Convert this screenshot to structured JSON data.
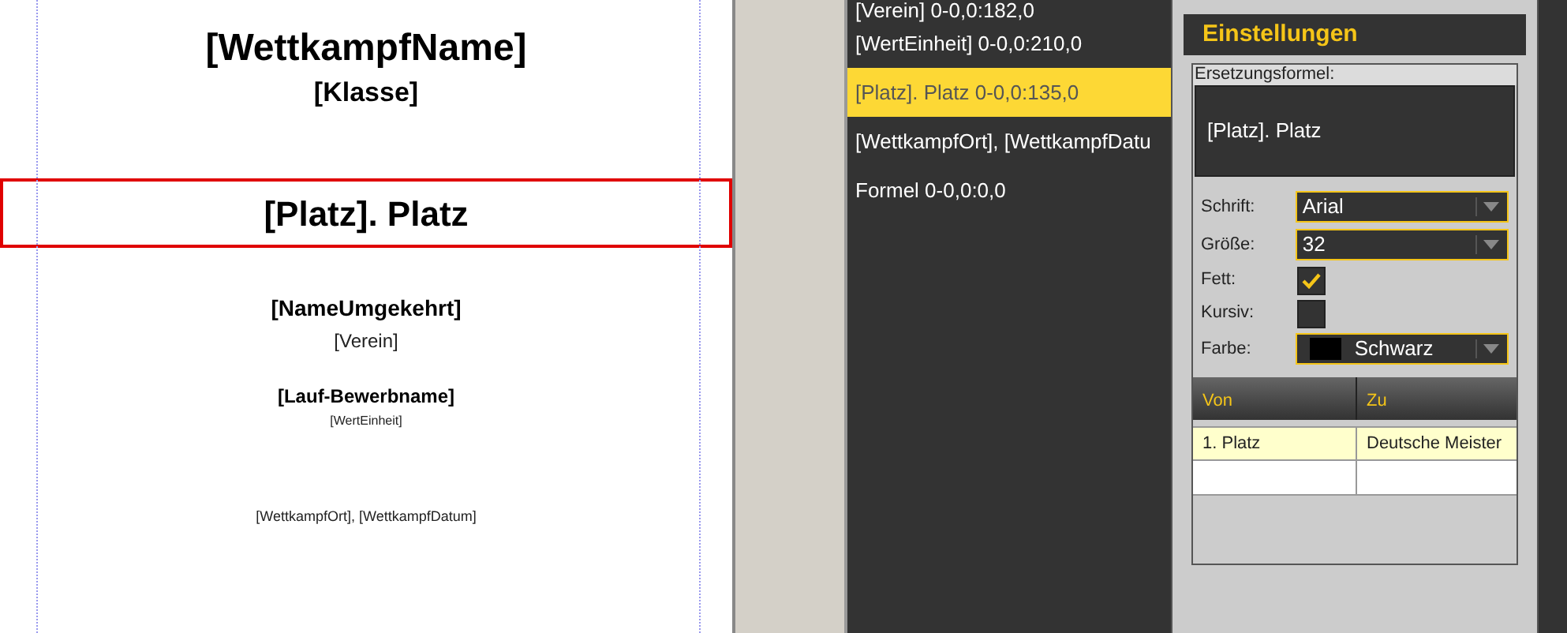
{
  "document": {
    "texts": [
      {
        "kind": "title",
        "text": "[WettkampfName]"
      },
      {
        "kind": "subtitle",
        "text": "[Klasse]"
      },
      {
        "kind": "place",
        "text": "[Platz]. Platz",
        "selected": true
      },
      {
        "kind": "name",
        "text": "[NameUmgekehrt]"
      },
      {
        "kind": "club",
        "text": "[Verein]"
      },
      {
        "kind": "event",
        "text": "[Lauf-Bewerbname]"
      },
      {
        "kind": "small",
        "text": "[WertEinheit]"
      },
      {
        "kind": "footer",
        "text": "[WettkampfOrt], [WettkampfDatum]"
      }
    ]
  },
  "elements": [
    {
      "label": "[Verein] 0-0,0:182,0",
      "selected": false
    },
    {
      "label": "[WertEinheit] 0-0,0:210,0",
      "selected": false
    },
    {
      "label": "[Platz]. Platz 0-0,0:135,0",
      "selected": true
    },
    {
      "label": "[WettkampfOrt], [WettkampfDatu",
      "selected": false
    },
    {
      "label": "Formel 0-0,0:0,0",
      "selected": false
    }
  ],
  "settings": {
    "title": "Einstellungen",
    "formula_label": "Ersetzungsformel:",
    "formula": "[Platz]. Platz",
    "font": {
      "label": "Schrift:",
      "value": "Arial"
    },
    "size": {
      "label": "Größe:",
      "value": "32"
    },
    "bold": {
      "label": "Fett:",
      "checked": true
    },
    "italic": {
      "label": "Kursiv:",
      "checked": false
    },
    "color": {
      "label": "Farbe:",
      "value": "Schwarz",
      "color": "#000000"
    },
    "table": {
      "columns": [
        "Von",
        "Zu"
      ],
      "rows": [
        [
          "1. Platz",
          "Deutsche Meister"
        ]
      ]
    }
  }
}
